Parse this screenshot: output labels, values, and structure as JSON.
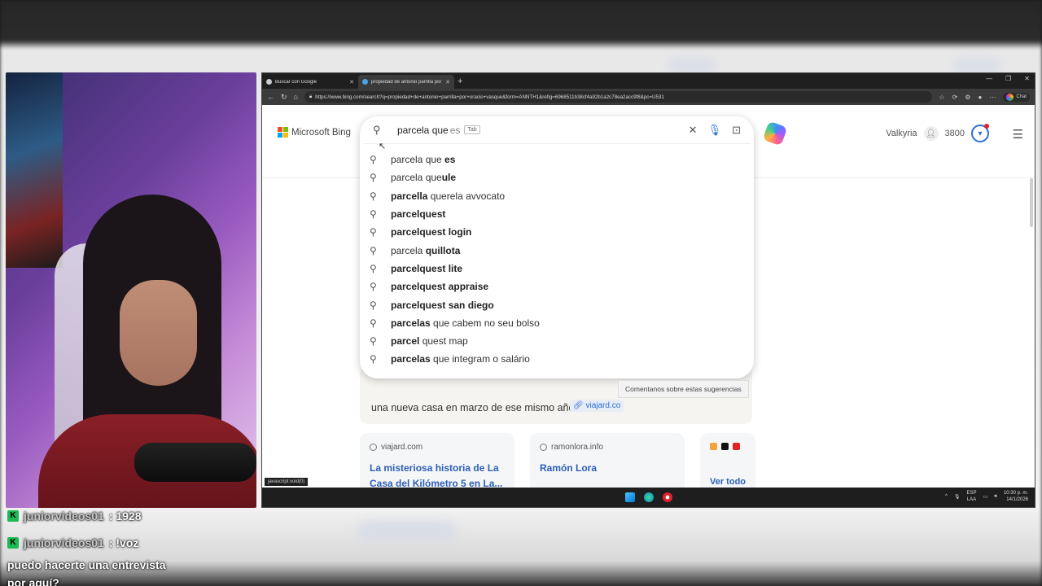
{
  "browser": {
    "tabs": [
      {
        "label": "Buscar con Google",
        "active": false
      },
      {
        "label": "propiedad de antonio parrilla por",
        "active": true
      }
    ],
    "url": "https://www.bing.com/search?q=propiedad+de+antonio+parrilla+por+oracio+vasque&form=ANNTH1&refig=6968511b38cf4a92b1a2c78ea2acc9f8&pc=U531",
    "chat_label": "Chat"
  },
  "bing": {
    "logo_text": "Microsoft Bing",
    "user_name": "Valkyria",
    "points": "3800",
    "search": {
      "query": "parcela que",
      "ghost": "es",
      "tab_hint": "Tab"
    },
    "suggestions": [
      {
        "pre": "parcela que ",
        "bold": "es",
        "post": ""
      },
      {
        "pre": "parcela que",
        "bold": "ule",
        "post": ""
      },
      {
        "pre": "",
        "bold": "parcella",
        "post": " querela avvocato"
      },
      {
        "pre": "",
        "bold": "parcelquest",
        "post": ""
      },
      {
        "pre": "",
        "bold": "parcelquest login",
        "post": ""
      },
      {
        "pre": "parcela ",
        "bold": "quillota",
        "post": ""
      },
      {
        "pre": "",
        "bold": "parcelquest lite",
        "post": ""
      },
      {
        "pre": "",
        "bold": "parcelquest appraise",
        "post": ""
      },
      {
        "pre": "",
        "bold": "parcelquest san diego",
        "post": ""
      },
      {
        "pre": "",
        "bold": "parcelas",
        "post": " que cabem no seu bolso"
      },
      {
        "pre": "",
        "bold": "parcel",
        "post": " quest map"
      },
      {
        "pre": "",
        "bold": "parcelas",
        "post": " que integram o salário"
      }
    ],
    "answer_text": "una nueva casa en marzo de ese mismo año.",
    "answer_source": "viajard.co",
    "feedback_label": "Comentanos sobre estas sugerencias",
    "cards": [
      {
        "domain": "viajard.com",
        "title": "La misteriosa historia de La Casa del Kilómetro 5 en La..."
      },
      {
        "domain": "ramonlora.info",
        "title": "Ramón Lora"
      }
    ],
    "see_all": "Ver todo",
    "status_link": "javascript:void(0)"
  },
  "taskbar": {
    "lang": "ESP",
    "lang_sub": "LAA",
    "time": "10:30 p. m.",
    "date": "14/1/2026"
  },
  "chat": {
    "lines": [
      {
        "user": "juniorvideos01",
        "text": " : 1928"
      },
      {
        "user": "juniorvideos01",
        "text": " : !voz"
      }
    ],
    "message": "puedo hacerte una entrevista por aquí?"
  },
  "colors": {
    "bing_link": "#2b5fb8",
    "accent": "#2b6fd6"
  }
}
